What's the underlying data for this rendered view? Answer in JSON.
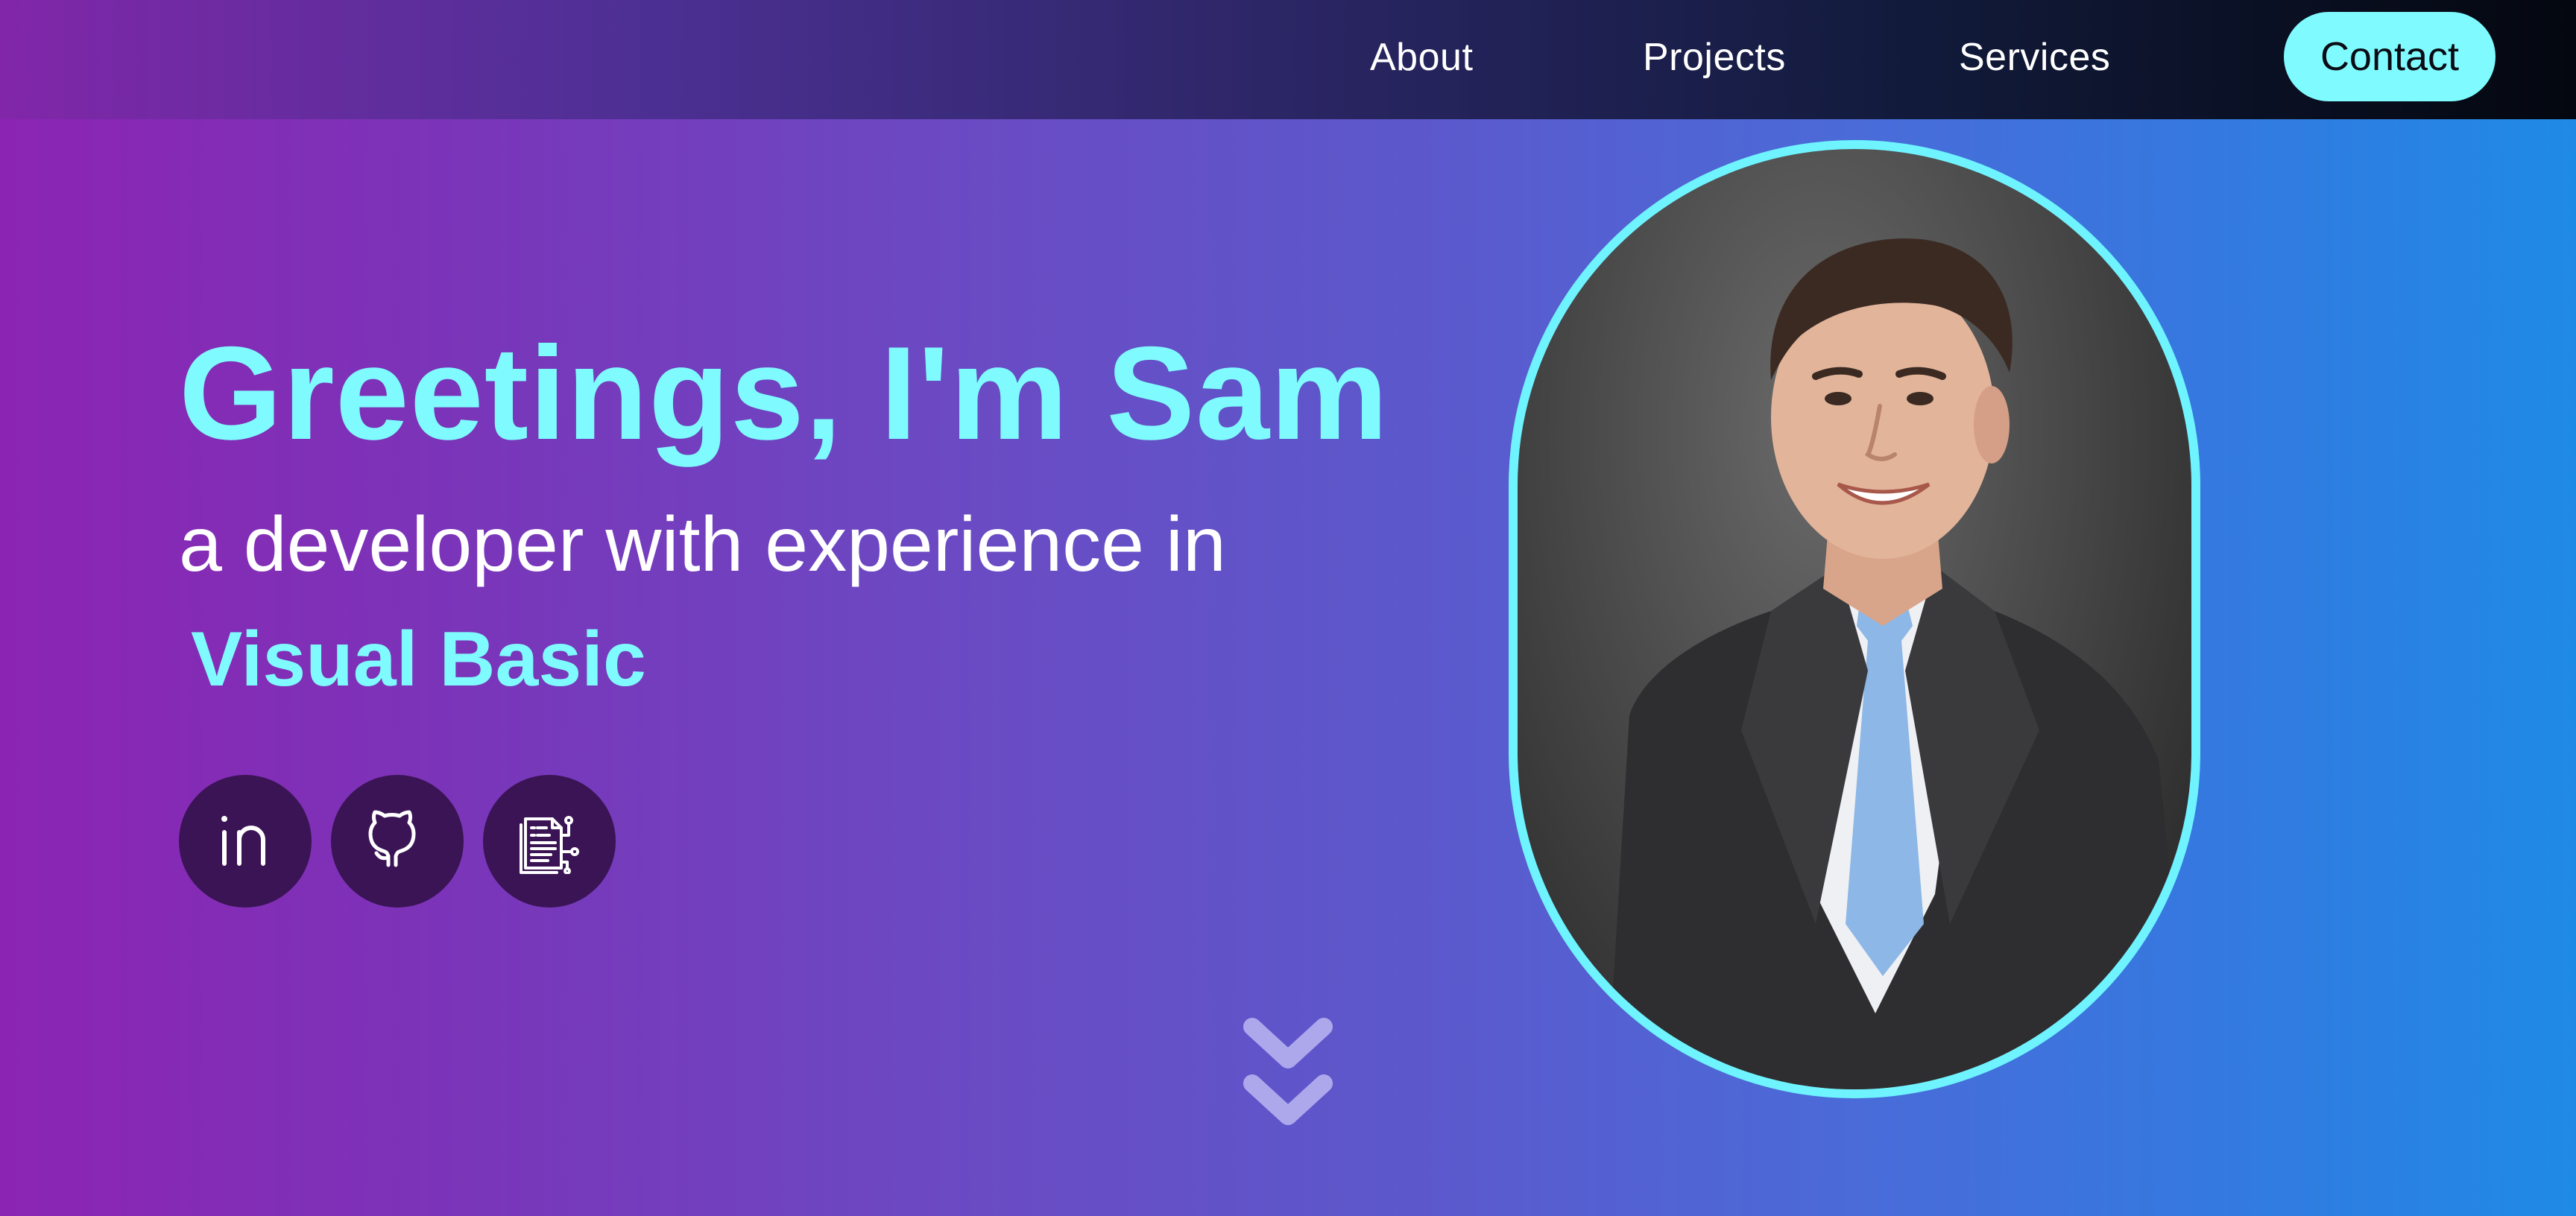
{
  "nav": {
    "about": "About",
    "projects": "Projects",
    "services": "Services",
    "contact": "Contact"
  },
  "hero": {
    "title": "Greetings, I'm Sam",
    "subtitle": "a developer with experience in",
    "skill": "Visual Basic"
  },
  "social": {
    "icons": [
      "linkedin-icon",
      "github-icon",
      "resume-icon"
    ]
  },
  "scroll": {
    "icon": "double-chevron-down-icon"
  },
  "colors": {
    "accent": "#7ffbff",
    "social_bg": "#3a1454",
    "gradient_start": "#8c24b3",
    "gradient_end": "#1f8ae6",
    "navbar_end": "#04070f"
  }
}
